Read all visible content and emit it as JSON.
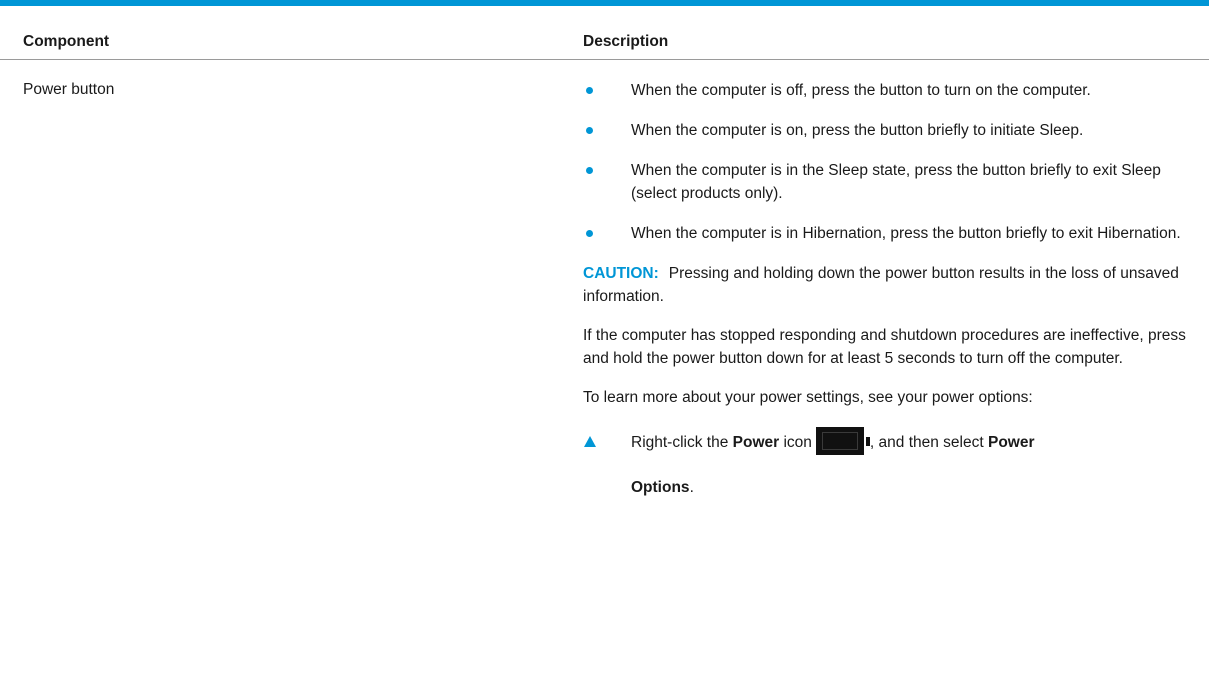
{
  "table": {
    "headers": {
      "component": "Component",
      "description": "Description"
    },
    "row": {
      "component": "Power button",
      "bullets": [
        "When the computer is off, press the button to turn on the computer.",
        "When the computer is on, press the button briefly to initiate Sleep.",
        "When the computer is in the Sleep state, press the button briefly to exit Sleep (select products only).",
        "When the computer is in Hibernation, press the button briefly to exit Hibernation."
      ],
      "caution": {
        "label": "CAUTION:",
        "text": "Pressing and holding down the power button results in the loss of unsaved information."
      },
      "paragraphs": [
        "If the computer has stopped responding and shutdown procedures are ineffective, press and hold the power button down for at least 5 seconds to turn off the computer.",
        "To learn more about your power settings, see your power options:"
      ],
      "step": {
        "prefix": "Right-click the",
        "power_word": "Power",
        "icon_word": "icon",
        "icon_name": "battery-icon",
        "middle": ", and then select",
        "option_word": "Power",
        "option_word2": "Options",
        "end": "."
      }
    }
  },
  "colors": {
    "accent": "#0096d6",
    "text": "#1a1a1a",
    "rule": "#9a9a9a"
  }
}
